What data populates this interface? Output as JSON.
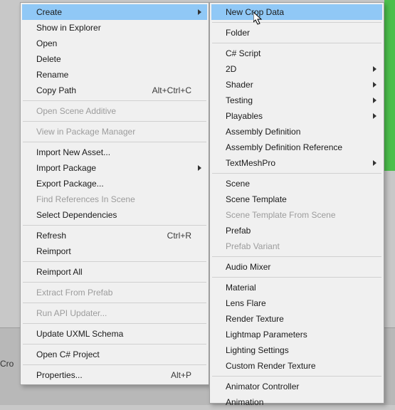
{
  "bg": {
    "truncated_label": "Cro"
  },
  "primary_menu": [
    {
      "type": "item",
      "key": "create",
      "label": "Create",
      "submenu": true,
      "highlight": true
    },
    {
      "type": "item",
      "key": "show-in-explorer",
      "label": "Show in Explorer"
    },
    {
      "type": "item",
      "key": "open",
      "label": "Open"
    },
    {
      "type": "item",
      "key": "delete",
      "label": "Delete"
    },
    {
      "type": "item",
      "key": "rename",
      "label": "Rename"
    },
    {
      "type": "item",
      "key": "copy-path",
      "label": "Copy Path",
      "shortcut": "Alt+Ctrl+C"
    },
    {
      "type": "sep"
    },
    {
      "type": "item",
      "key": "open-scene-additive",
      "label": "Open Scene Additive",
      "disabled": true
    },
    {
      "type": "sep"
    },
    {
      "type": "item",
      "key": "view-in-package-manager",
      "label": "View in Package Manager",
      "disabled": true
    },
    {
      "type": "sep"
    },
    {
      "type": "item",
      "key": "import-new-asset",
      "label": "Import New Asset..."
    },
    {
      "type": "item",
      "key": "import-package",
      "label": "Import Package",
      "submenu": true
    },
    {
      "type": "item",
      "key": "export-package",
      "label": "Export Package..."
    },
    {
      "type": "item",
      "key": "find-references",
      "label": "Find References In Scene",
      "disabled": true
    },
    {
      "type": "item",
      "key": "select-dependencies",
      "label": "Select Dependencies"
    },
    {
      "type": "sep"
    },
    {
      "type": "item",
      "key": "refresh",
      "label": "Refresh",
      "shortcut": "Ctrl+R"
    },
    {
      "type": "item",
      "key": "reimport",
      "label": "Reimport"
    },
    {
      "type": "sep"
    },
    {
      "type": "item",
      "key": "reimport-all",
      "label": "Reimport All"
    },
    {
      "type": "sep"
    },
    {
      "type": "item",
      "key": "extract-from-prefab",
      "label": "Extract From Prefab",
      "disabled": true
    },
    {
      "type": "sep"
    },
    {
      "type": "item",
      "key": "run-api-updater",
      "label": "Run API Updater...",
      "disabled": true
    },
    {
      "type": "sep"
    },
    {
      "type": "item",
      "key": "update-uxml-schema",
      "label": "Update UXML Schema"
    },
    {
      "type": "sep"
    },
    {
      "type": "item",
      "key": "open-csharp-project",
      "label": "Open C# Project"
    },
    {
      "type": "sep"
    },
    {
      "type": "item",
      "key": "properties",
      "label": "Properties...",
      "shortcut": "Alt+P"
    }
  ],
  "secondary_menu": [
    {
      "type": "item",
      "key": "new-crop-data",
      "label": "New Crop Data",
      "highlight": true
    },
    {
      "type": "sep"
    },
    {
      "type": "item",
      "key": "folder",
      "label": "Folder"
    },
    {
      "type": "sep"
    },
    {
      "type": "item",
      "key": "csharp-script",
      "label": "C# Script"
    },
    {
      "type": "item",
      "key": "2d",
      "label": "2D",
      "submenu": true
    },
    {
      "type": "item",
      "key": "shader",
      "label": "Shader",
      "submenu": true
    },
    {
      "type": "item",
      "key": "testing",
      "label": "Testing",
      "submenu": true
    },
    {
      "type": "item",
      "key": "playables",
      "label": "Playables",
      "submenu": true
    },
    {
      "type": "item",
      "key": "assembly-definition",
      "label": "Assembly Definition"
    },
    {
      "type": "item",
      "key": "assembly-definition-reference",
      "label": "Assembly Definition Reference"
    },
    {
      "type": "item",
      "key": "textmeshpro",
      "label": "TextMeshPro",
      "submenu": true
    },
    {
      "type": "sep"
    },
    {
      "type": "item",
      "key": "scene",
      "label": "Scene"
    },
    {
      "type": "item",
      "key": "scene-template",
      "label": "Scene Template"
    },
    {
      "type": "item",
      "key": "scene-template-from-scene",
      "label": "Scene Template From Scene",
      "disabled": true
    },
    {
      "type": "item",
      "key": "prefab",
      "label": "Prefab"
    },
    {
      "type": "item",
      "key": "prefab-variant",
      "label": "Prefab Variant",
      "disabled": true
    },
    {
      "type": "sep"
    },
    {
      "type": "item",
      "key": "audio-mixer",
      "label": "Audio Mixer"
    },
    {
      "type": "sep"
    },
    {
      "type": "item",
      "key": "material",
      "label": "Material"
    },
    {
      "type": "item",
      "key": "lens-flare",
      "label": "Lens Flare"
    },
    {
      "type": "item",
      "key": "render-texture",
      "label": "Render Texture"
    },
    {
      "type": "item",
      "key": "lightmap-parameters",
      "label": "Lightmap Parameters"
    },
    {
      "type": "item",
      "key": "lighting-settings",
      "label": "Lighting Settings"
    },
    {
      "type": "item",
      "key": "custom-render-texture",
      "label": "Custom Render Texture"
    },
    {
      "type": "sep"
    },
    {
      "type": "item",
      "key": "animator-controller",
      "label": "Animator Controller"
    },
    {
      "type": "item",
      "key": "animation",
      "label": "Animation"
    }
  ]
}
